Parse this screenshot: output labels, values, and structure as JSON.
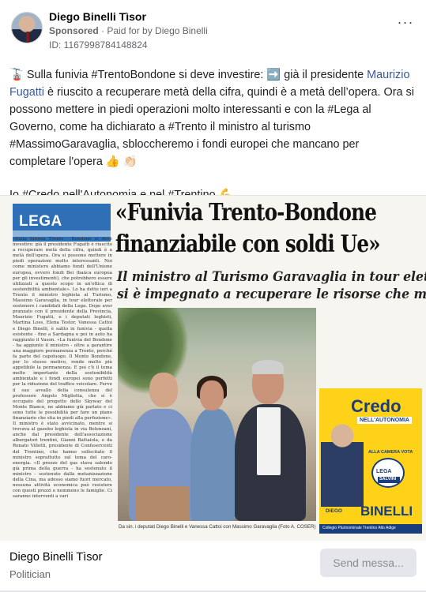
{
  "post": {
    "page_name": "Diego Binelli Tìsor",
    "sponsored_label": "Sponsored",
    "paid_for": "Paid for by Diego Binelli",
    "id_line": "ID: 1167998784148824",
    "more_icon": "more-horizontal-icon",
    "paragraph1": {
      "part1": "🚡 Sulla funivia #TrentoBondone si deve investire: ➡️ già il presidente ",
      "mention": "Maurizio Fugatti",
      "part2": " è riuscito a recuperare metà della cifra, quindi è a metà dell’opera. Ora si possono mettere in piedi operazioni molto interessanti e con la #Lega al Governo, come ha dichiarato a #Trento il ministro al turismo #MassimoGaravaglia, sbloccheremo i fondi europei che mancano per completare l'opera 👍 👏🏻"
    },
    "paragraph2": "Io #Credo nell'Autonomia e nel #Trentino 💪 ..."
  },
  "article": {
    "section_label": "LEGA",
    "headline_line1": "«Funivia Trento-Bondone",
    "headline_line2": "finanziabile con soldi Ue»",
    "subhead_line1": "Il ministro al Turismo Garavaglia in tour elettorale",
    "subhead_line2": "si è impegnato a recuperare le risorse che mancano",
    "column_text": "«Sulla funivia Trento - Bondone si deve investire: già il presidente Fugatti è riuscito a recuperare metà della cifra, quindi è a metà dell'opera. Ora si possono mettere in piedi operazioni molto interessanti. Noi come ministero abbiamo fondi dell'Unione europea, ovvero fondi Bei (banca europea per gli investimenti), che potrebbero essere utilizzati a questo scopo in un'ottica di sostenibilità ambientale». Lo ha detto ieri a Trento il ministro leghista al Turismo, Massimo Garavaglia, in tour elettorale per sostenere i candidati della Lega. Dopo aver pranzato con il presidente della Provincia, Maurizio Fugatti, e i deputati leghisti, Martina Loss, Elena Testor, Vanessa Cattoi e Diego Binelli, è salito in funivia - quella esistente - fino a Sardagna e poi in auto ha raggiunto il Vason. «La funivia del Bondone - ha aggiunto il ministro - oltre a garantire una maggiore permanenza a Trento, perché fa parte del capoluogo. Il Monte Bondone, per lo stesso motivo, rende molto più appetibile la permanenza. E poi c'è il tema molto importante della sostenibilità ambientale e i fondi europei sono perfetti per la riduzione del traffico veicolare. Ferve il suo avvallo della consulenza del professore Angelo Miglietta, che si è occupato del progetto dello Skyway del Monte Bianco, ne abbiamo già parlato e ci sono tutte le possibilità per fare un piano finanziario che stia in piedi alla perfezione». Il ministro è stato avvicinato, mentre si trovava al gazebo leghista in via Belenzani, anche dal presidente dell'associazione albergatori trentini, Gianni Battaiola, e da Renato Villotti, presidente di Confesercenti del Trentino, che hanno sollecitato il ministro soprattutto sul tema del caro-energia. «Il prezzo del gas stava salendo già prima della guerra - ha sostenuto il ministro - sostenuto dalla metanizzazione della Cina, ma adesso siamo fuori mercato, nessuna attività economica può resistere con questi prezzi e nemmeno le famiglie. Ci saranno interventi a vari",
    "photo_caption": "Da sin. i deputati Diego Binelli e Vanessa Cattoi con Massimo Garavaglia (Foto A. COSER)",
    "poster": {
      "title": "Credo",
      "subtitle": "NELL'AUTONOMIA",
      "camera_text": "ALLA CAMERA VOTA",
      "logo_text": "LEGA",
      "logo_salvini": "SALVINI",
      "name_first": "DIEGO",
      "name_last": "BINELLI",
      "footer_text": "Collegio Plurinominale Trentino Alto Adige"
    }
  },
  "footer": {
    "page_name": "Diego Binelli Tìsor",
    "category": "Politician",
    "cta_label": "Send messa..."
  }
}
